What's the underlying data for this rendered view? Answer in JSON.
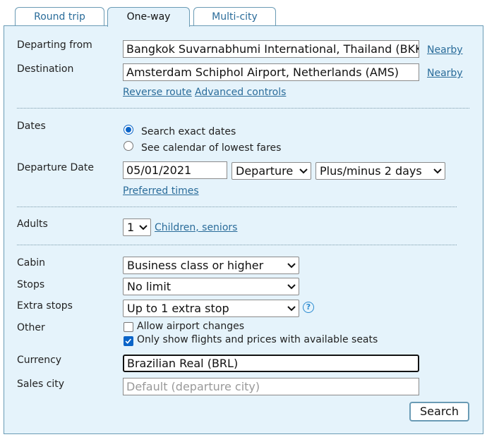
{
  "tabs": [
    {
      "label": "Round trip",
      "active": false
    },
    {
      "label": "One-way",
      "active": true
    },
    {
      "label": "Multi-city",
      "active": false
    }
  ],
  "route": {
    "departing_label": "Departing from",
    "departing_value": "Bangkok Suvarnabhumi International, Thailand (BKK)",
    "destination_label": "Destination",
    "destination_value": "Amsterdam Schiphol Airport, Netherlands (AMS)",
    "nearby_label": "Nearby",
    "reverse_label": "Reverse route",
    "advanced_label": "Advanced controls"
  },
  "dates": {
    "label": "Dates",
    "option_exact": "Search exact dates",
    "option_calendar": "See calendar of lowest fares",
    "selected": "exact",
    "departure_label": "Departure Date",
    "departure_value": "05/01/2021",
    "date_type": "Departure",
    "flex": "Plus/minus 2 days",
    "preferred_times": "Preferred times"
  },
  "passengers": {
    "adults_label": "Adults",
    "adults_value": "1",
    "children_link": "Children, seniors"
  },
  "options": {
    "cabin_label": "Cabin",
    "cabin_value": "Business class or higher",
    "stops_label": "Stops",
    "stops_value": "No limit",
    "extra_stops_label": "Extra stops",
    "extra_stops_value": "Up to 1 extra stop",
    "other_label": "Other",
    "allow_airport_changes": "Allow airport changes",
    "allow_airport_changes_checked": false,
    "only_available": "Only show flights and prices with available seats",
    "only_available_checked": true,
    "currency_label": "Currency",
    "currency_value": "Brazilian Real (BRL)",
    "sales_city_label": "Sales city",
    "sales_city_placeholder": "Default (departure city)"
  },
  "search_button": "Search",
  "colors": {
    "panel_bg": "#e5f3fb",
    "border": "#6a9bb5",
    "link": "#2a6c9a",
    "accent": "#0a64c8"
  }
}
